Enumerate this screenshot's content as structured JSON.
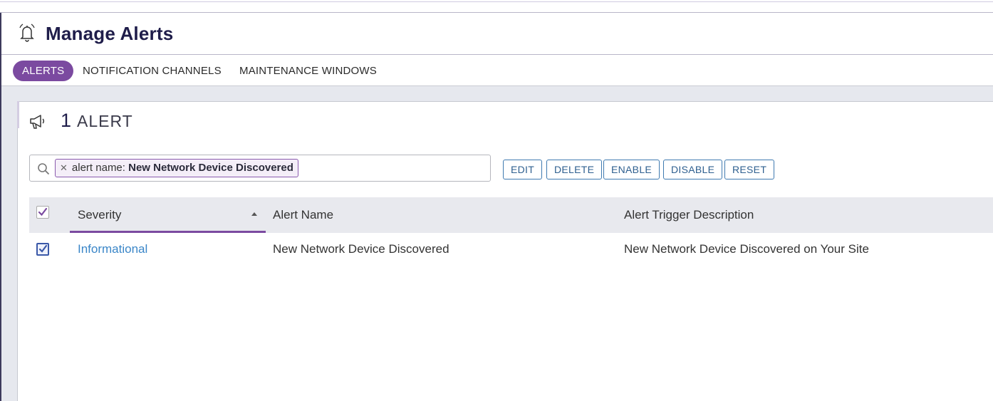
{
  "header": {
    "title": "Manage Alerts",
    "icon": "bell-icon"
  },
  "tabs": [
    {
      "label": "ALERTS",
      "active": true
    },
    {
      "label": "NOTIFICATION CHANNELS",
      "active": false
    },
    {
      "label": "MAINTENANCE WINDOWS",
      "active": false
    }
  ],
  "summary": {
    "count": "1",
    "label": "ALERT",
    "icon": "megaphone-icon"
  },
  "filter": {
    "chip_key": "alert name:",
    "chip_value": "New Network Device Discovered"
  },
  "actions": {
    "edit": "EDIT",
    "delete": "DELETE",
    "enable": "ENABLE",
    "disable": "DISABLE",
    "reset": "RESET"
  },
  "table": {
    "columns": [
      "Severity",
      "Alert Name",
      "Alert Trigger Description"
    ],
    "sorted_column": "Severity",
    "rows": [
      {
        "severity": "Informational",
        "name": "New Network Device Discovered",
        "description": "New Network Device Discovered on Your Site",
        "selected": true
      }
    ]
  },
  "colors": {
    "accent": "#7b4aa0",
    "title": "#1f1d4a",
    "button": "#3f7ab0",
    "link": "#3a86c8"
  }
}
